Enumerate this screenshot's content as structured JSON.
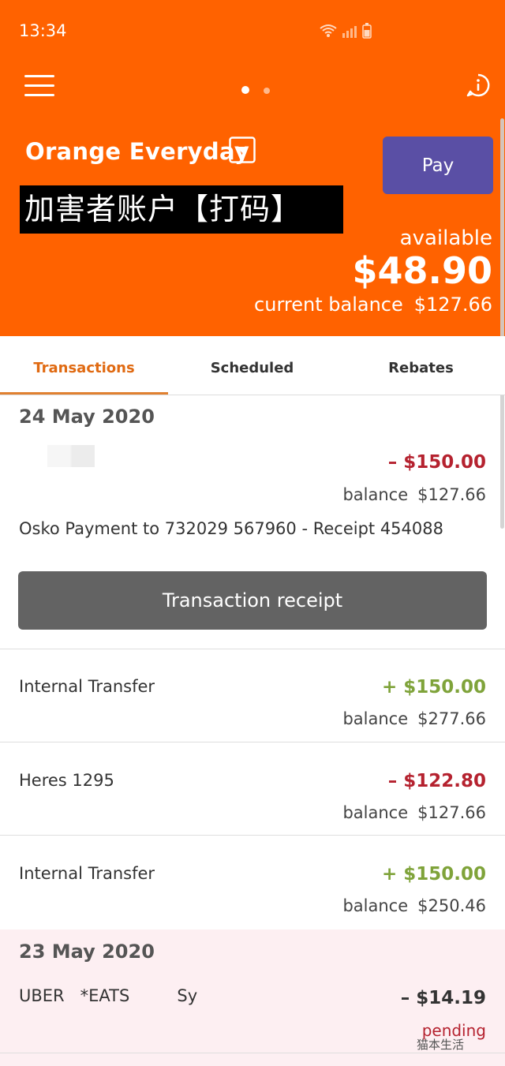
{
  "status_bar": {
    "time": "13:34"
  },
  "header": {
    "account_name": "Orange Everyday",
    "redacted_banner": "加害者账户【打码】",
    "pay_label": "Pay",
    "available_label": "available",
    "available_amount": "$48.90",
    "current_balance_label": "current balance",
    "current_balance_amount": "$127.66"
  },
  "tabs": [
    {
      "label": "Transactions",
      "active": true
    },
    {
      "label": "Scheduled",
      "active": false
    },
    {
      "label": "Rebates",
      "active": false
    }
  ],
  "transactions": {
    "group1": {
      "date": "24 May 2020",
      "expanded": {
        "amount": "– $150.00",
        "balance_label": "balance",
        "balance": "$127.66",
        "description": "Osko Payment to 732029 567960 - Receipt 454088",
        "receipt_button": "Transaction receipt"
      },
      "items": [
        {
          "name": "Internal Transfer",
          "amount": "+ $150.00",
          "balance_label": "balance",
          "balance": "$277.66"
        },
        {
          "name": "Heres 1295",
          "amount": "– $122.80",
          "balance_label": "balance",
          "balance": "$127.66"
        },
        {
          "name": "Internal Transfer",
          "amount": "+ $150.00",
          "balance_label": "balance",
          "balance": "$250.46"
        }
      ]
    },
    "group2": {
      "date": "23 May 2020",
      "items": [
        {
          "name": "UBER   *EATS         Sy",
          "amount": "– $14.19",
          "status": "pending"
        }
      ]
    }
  },
  "watermark": "猫本生活",
  "colors": {
    "brand_orange": "#ff6200",
    "pay_button": "#5a4fa5",
    "debit": "#b5222f",
    "credit": "#7fa33a",
    "active_tab": "#e06a12"
  }
}
